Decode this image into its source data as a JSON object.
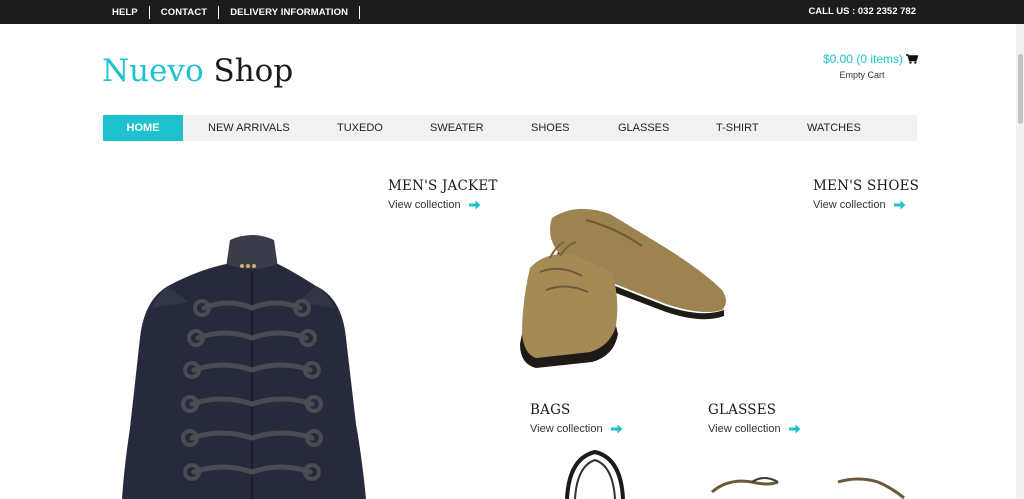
{
  "topbar": {
    "links": [
      "HELP",
      "CONTACT",
      "DELIVERY INFORMATION"
    ],
    "call_us": "CALL US : 032 2352 782"
  },
  "logo": {
    "part1": "Nuevo",
    "part2": "Shop"
  },
  "cart": {
    "total": "$0.00 (0 items)",
    "status": "Empty Cart",
    "icon": "cart-icon"
  },
  "nav": {
    "items": [
      "HOME",
      "NEW ARRIVALS",
      "TUXEDO",
      "SWEATER",
      "SHOES",
      "GLASSES",
      "T-SHIRT",
      "WATCHES"
    ],
    "active": "HOME"
  },
  "products": [
    {
      "title": "MEN'S JACKET",
      "link": "View collection"
    },
    {
      "title": "MEN'S SHOES",
      "link": "View collection"
    },
    {
      "title": "BAGS",
      "link": "View collection"
    },
    {
      "title": "GLASSES",
      "link": "View collection"
    }
  ],
  "colors": {
    "accent": "#1ec2cf",
    "topbar": "#1c1c1c",
    "nav_bg": "#f2f2f2"
  }
}
